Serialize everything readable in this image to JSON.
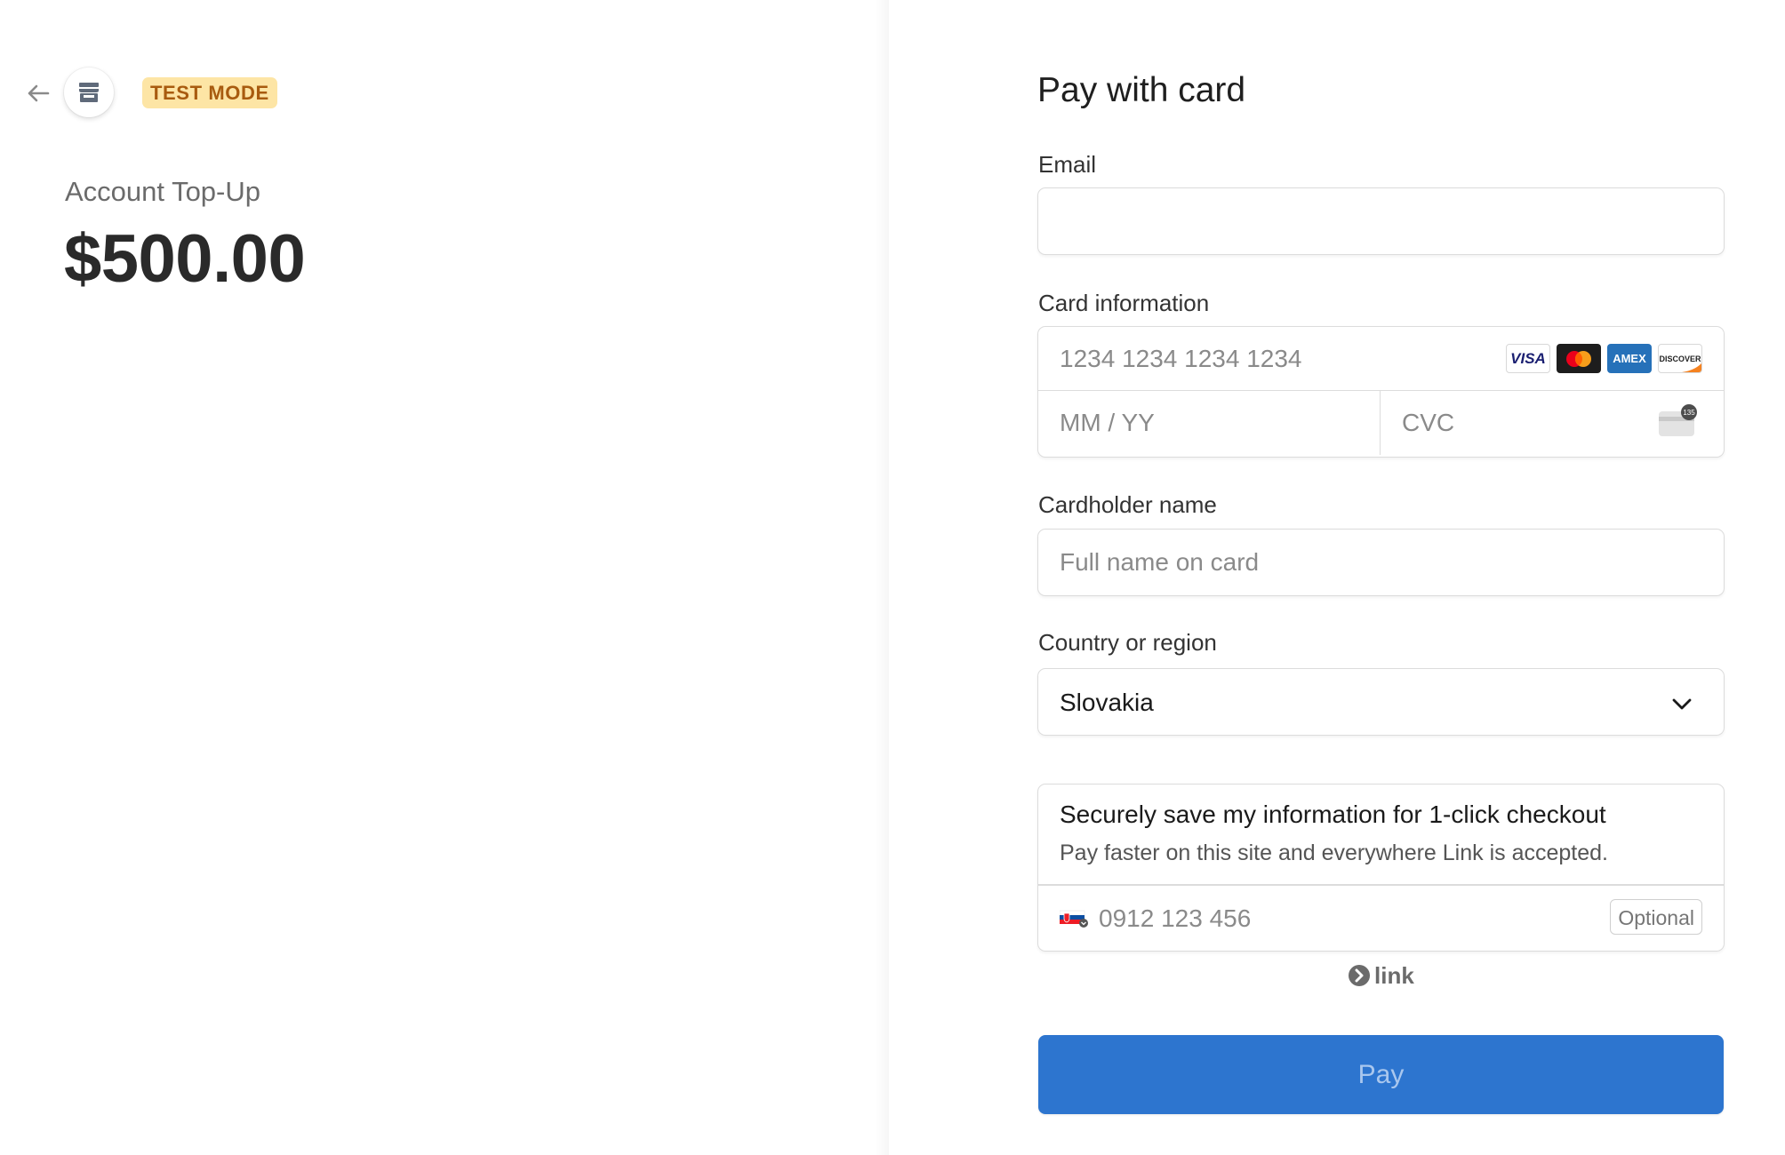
{
  "header": {
    "back_icon": "arrow-left-icon",
    "store_icon": "store-icon",
    "test_mode_label": "TEST MODE"
  },
  "summary": {
    "product_name": "Account Top-Up",
    "amount": "$500.00"
  },
  "form": {
    "title": "Pay with card",
    "email": {
      "label": "Email",
      "value": "",
      "placeholder": ""
    },
    "card": {
      "label": "Card information",
      "number_placeholder": "1234 1234 1234 1234",
      "expiry_placeholder": "MM / YY",
      "cvc_placeholder": "CVC",
      "cvc_icon": "card-cvc-icon",
      "brands": {
        "visa": "VISA",
        "amex": "AMEX",
        "discover": "DISCOVER"
      }
    },
    "cardholder": {
      "label": "Cardholder name",
      "placeholder": "Full name on card"
    },
    "country": {
      "label": "Country or region",
      "selected": "Slovakia"
    },
    "link": {
      "title": "Securely save my information for 1-click checkout",
      "description": "Pay faster on this site and everywhere Link is accepted.",
      "phone_placeholder": "0912 123 456",
      "optional_label": "Optional",
      "brand_label": "link"
    },
    "pay_button_label": "Pay"
  },
  "colors": {
    "accent": "#2d75cf",
    "test_badge_bg": "#fde5a5",
    "test_badge_text": "#a85b0f"
  }
}
